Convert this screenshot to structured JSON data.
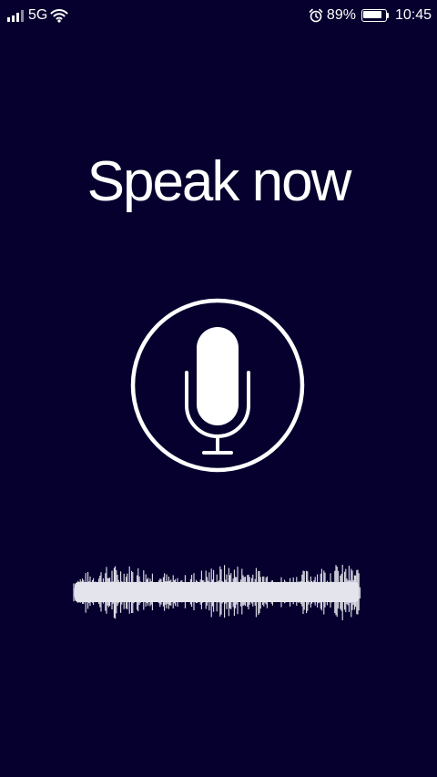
{
  "status_bar": {
    "network": "5G",
    "signal_bars": 4,
    "signal_bars_active": 3,
    "battery_percent": "89%",
    "battery_level": 0.89,
    "time": "10:45",
    "icons": [
      "signal-icon",
      "wifi-icon",
      "alarm-icon",
      "battery-icon"
    ]
  },
  "prompt": {
    "title": "Speak now"
  },
  "mic": {
    "icon": "microphone-icon",
    "state": "listening"
  },
  "colors": {
    "background": "#05002e",
    "foreground": "#ffffff",
    "waveform": "#e4e4ec"
  }
}
